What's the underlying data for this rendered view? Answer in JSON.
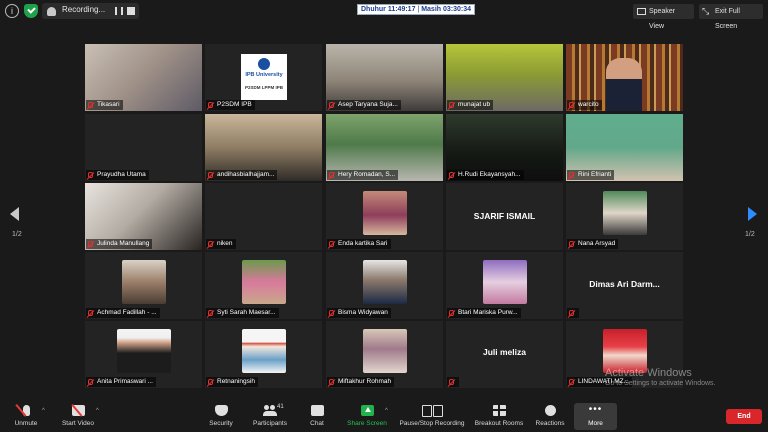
{
  "topbar": {
    "recording_label": "Recording...",
    "time_label": "Dhuhur 11:49:17",
    "time_sep": "|",
    "remaining_label": "Masih 03:30:34",
    "speaker_view_label": "Speaker View",
    "exit_full_screen_label": "Exit Full Screen"
  },
  "pagination": {
    "left": "1/2",
    "right": "1/2"
  },
  "tiles": [
    {
      "name": "Tikasari"
    },
    {
      "name": "P2SDM IPB",
      "logo_title": "IPB University",
      "logo_sub": "P2SDM LPPM IPB"
    },
    {
      "name": "Asep Taryana Suja..."
    },
    {
      "name": "munajat ub"
    },
    {
      "name": "warcito"
    },
    {
      "name": "Prayudha Utama"
    },
    {
      "name": "andihasbialhajjam..."
    },
    {
      "name": "Hery Romadan, S..."
    },
    {
      "name": "H.Rudi Ekayansyah..."
    },
    {
      "name": "Rini Efrianti"
    },
    {
      "name": "Julinda Manullang"
    },
    {
      "name": "niken"
    },
    {
      "name": "Enda kartika Sari"
    },
    {
      "name": "",
      "big_name": "SJARIF ISMAIL"
    },
    {
      "name": "Nana Arsyad"
    },
    {
      "name": "Achmad Fadillah - ..."
    },
    {
      "name": "Syti Sarah Maesar..."
    },
    {
      "name": "Bisma Widyawan"
    },
    {
      "name": "Btari Mariska Purw..."
    },
    {
      "name": "",
      "big_name": "Dimas Ari Darm..."
    },
    {
      "name": "Anita Primaswari ..."
    },
    {
      "name": "Retnaningsih"
    },
    {
      "name": "Miftakhur Rohmah"
    },
    {
      "name": "",
      "big_name": "Juli meliza"
    },
    {
      "name": "LINDAWATI MZ..."
    }
  ],
  "watermark": {
    "line1": "Activate Windows",
    "line2": "Go to Settings to activate Windows."
  },
  "toolbar": {
    "unmute": "Unmute",
    "start_video": "Start Video",
    "security": "Security",
    "participants": "Participants",
    "participants_count": "41",
    "chat": "Chat",
    "share_screen": "Share Screen",
    "pause_stop_recording": "Pause/Stop Recording",
    "breakout_rooms": "Breakout Rooms",
    "reactions": "Reactions",
    "more": "More",
    "more_dots": "•••",
    "end": "End"
  },
  "colors": {
    "background": "#1a1a1a",
    "active_speaker_border": "#e8d33a",
    "share_green": "#28c054",
    "end_red": "#d8262b",
    "next_arrow_blue": "#2d8cff"
  }
}
